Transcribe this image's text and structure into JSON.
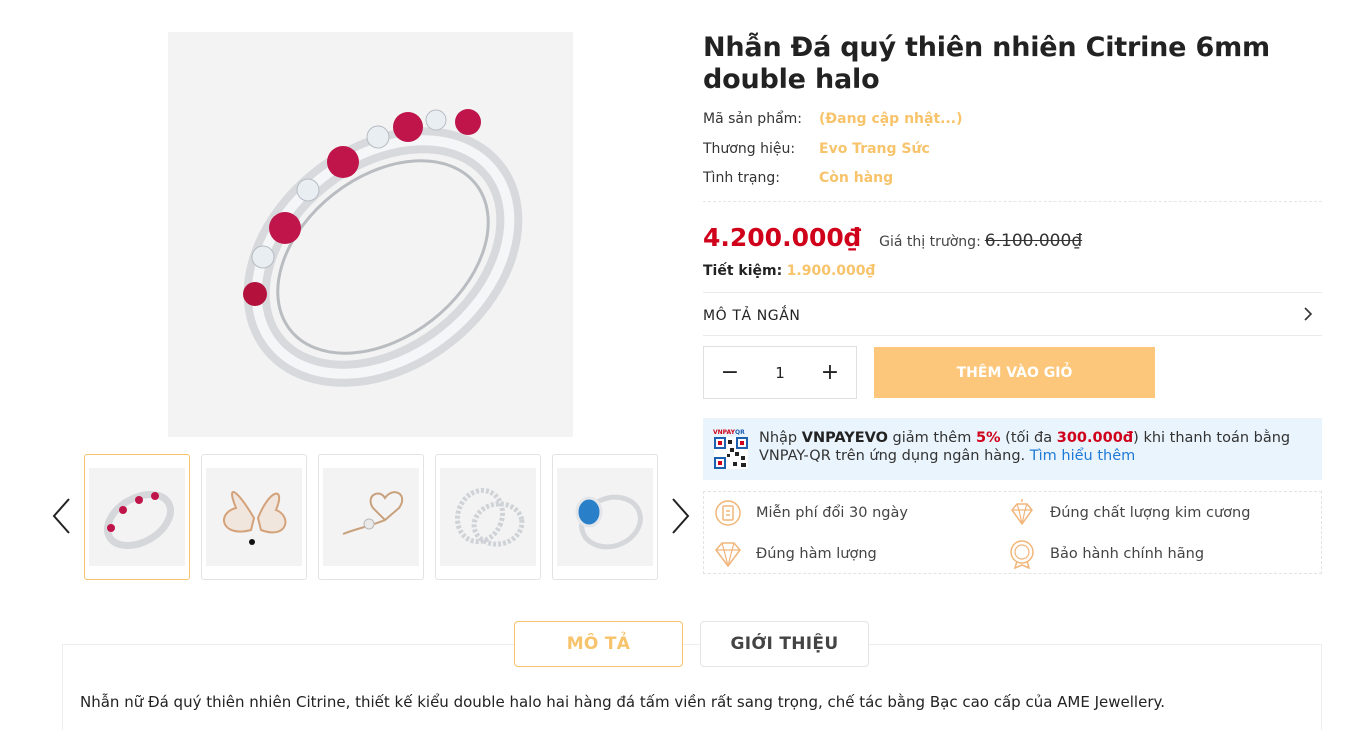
{
  "product": {
    "title": "Nhẫn Đá quý thiên nhiên Citrine 6mm double halo",
    "meta": [
      {
        "label": "Mã sản phẩm:",
        "value": "(Đang cập nhật...)"
      },
      {
        "label": "Thương hiệu:",
        "value": "Evo Trang Sức"
      },
      {
        "label": "Tình trạng:",
        "value": "Còn hàng"
      }
    ],
    "price_current": "4.200.000₫",
    "price_market_label": "Giá thị trường:",
    "price_market": "6.100.000₫",
    "saving_label": "Tiết kiệm:",
    "saving_value": "1.900.000₫"
  },
  "short_description": {
    "label": "MÔ TẢ NGẮN",
    "icon": "chevron-right-icon"
  },
  "purchase": {
    "quantity": "1",
    "decrease_label": "−",
    "increase_label": "+",
    "add_to_cart_label": "THÊM VÀO GIỎ"
  },
  "vnpay": {
    "icon": "vnpay-qr-icon",
    "prefix": "Nhập ",
    "code": "VNPAYEVO",
    "middle1": " giảm thêm ",
    "percent": "5%",
    "middle2": " (tối đa ",
    "max_amount": "300.000đ",
    "suffix": ") khi thanh toán bằng VNPAY-QR trên ứng dụng ngân hàng. ",
    "link": "Tìm hiểu thêm"
  },
  "policies": [
    {
      "label": "Miễn phí đổi 30 ngày",
      "icon": "exchange-icon"
    },
    {
      "label": "Đúng chất lượng kim cương",
      "icon": "diamond-quality-icon"
    },
    {
      "label": "Đúng hàm lượng",
      "icon": "diamond-icon"
    },
    {
      "label": "Bảo hành chính hãng",
      "icon": "warranty-icon"
    }
  ],
  "gallery": {
    "thumbnails": [
      "ruby-ring",
      "butterfly-brooch",
      "heart-flower-brooch",
      "eternity-rings",
      "sapphire-ring"
    ],
    "active_index": 0
  },
  "tabs": [
    {
      "label": "MÔ TẢ",
      "active": true
    },
    {
      "label": "GIỚI THIỆU",
      "active": false
    }
  ],
  "description": "Nhẫn nữ Đá quý thiên nhiên Citrine, thiết kế kiểu double halo hai hàng đá tấm viền rất sang trọng, chế tác bằng Bạc cao cấp của AME Jewellery.",
  "colors": {
    "accent": "#f7c36b",
    "button": "#fcc77a",
    "price": "#d0021b",
    "link": "#1f7ad6",
    "vnpay_bg": "#e9f4fc"
  }
}
